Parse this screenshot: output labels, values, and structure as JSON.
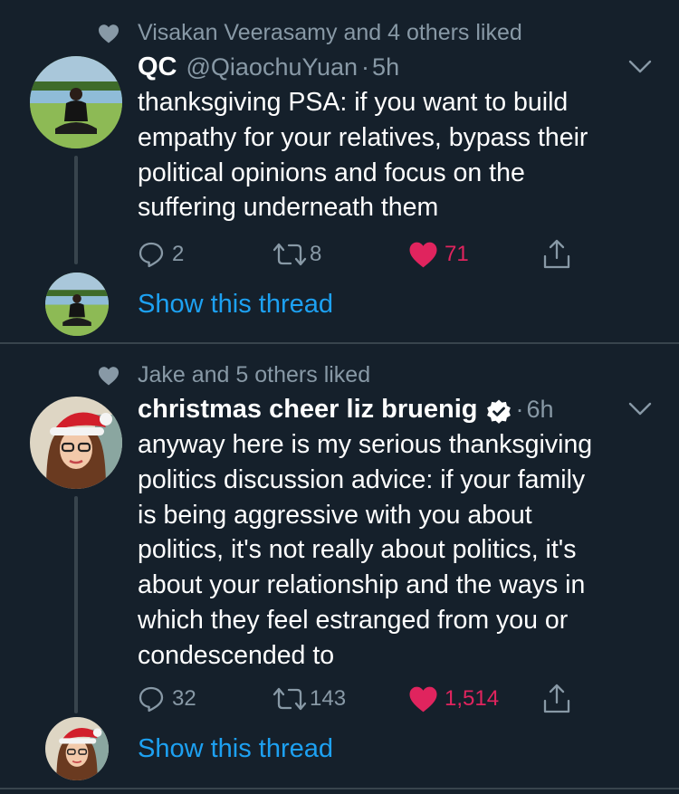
{
  "tweets": [
    {
      "social_context": "Visakan Veerasamy and 4 others liked",
      "name": "QC",
      "handle": "@QiaochuYuan",
      "time": "5h",
      "lines": [
        "thanksgiving PSA: if you want to build",
        "empathy for your relatives, bypass their",
        "political opinions and focus on the",
        "suffering underneath them"
      ],
      "replies": "2",
      "retweets": "8",
      "likes": "71",
      "show_thread": "Show this thread"
    },
    {
      "social_context": "Jake and 5 others liked",
      "name": "christmas cheer liz bruenig",
      "handle": "",
      "time": "6h",
      "lines": [
        "anyway here is my serious thanksgiving",
        "politics discussion advice: if your family",
        "is being aggressive with you about",
        "politics, it's not really about politics, it's",
        "about your relationship and the ways in",
        "which they feel estranged from you or",
        "condescended to"
      ],
      "replies": "32",
      "retweets": "143",
      "likes": "1,514",
      "show_thread": "Show this thread"
    }
  ],
  "icons": {
    "social": "heart-icon",
    "caret": "chevron-down-icon",
    "reply": "reply-icon",
    "retweet": "retweet-icon",
    "like": "heart-filled-icon",
    "share": "share-icon",
    "verified": "verified-badge-icon"
  },
  "colors": {
    "background": "#15202b",
    "text": "#ffffff",
    "secondary": "#8899a6",
    "link": "#1da1f2",
    "like": "#e0245e",
    "divider": "#38444d"
  }
}
